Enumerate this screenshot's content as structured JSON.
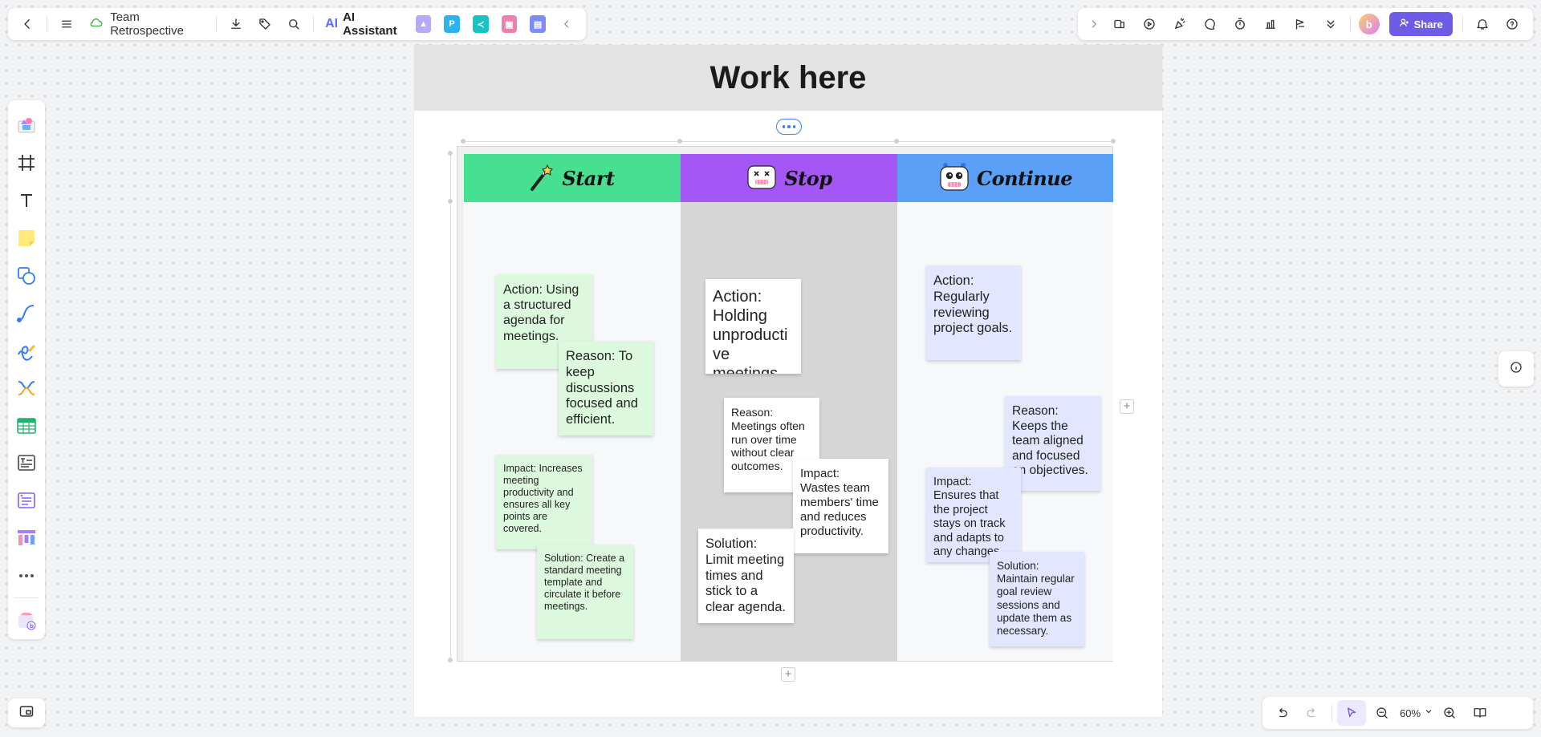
{
  "toolbar": {
    "doc_title": "Team Retrospective",
    "ai_label": "AI Assistant",
    "share_label": "Share",
    "zoom": "60%"
  },
  "frame": {
    "title": "Work here"
  },
  "columns": [
    {
      "title": "Start",
      "color": "#46e090",
      "body_color": "#f6f8fa"
    },
    {
      "title": "Stop",
      "color": "#a457f5",
      "body_color": "#d6d6d6"
    },
    {
      "title": "Continue",
      "color": "#5aa0f7",
      "body_color": "#f6f8fa"
    }
  ],
  "notes": {
    "start_action": "Action: Using a structured agenda for meetings.",
    "start_reason": "Reason: To keep discussions focused and efficient.",
    "start_impact": "Impact: Increases meeting productivity and ensures all key points are covered.",
    "start_solution": "Solution: Create a standard meeting template and circulate it before meetings.",
    "stop_action": "Action: Holding unproductive meetings.",
    "stop_reason": "Reason: Meetings often run over time without clear outcomes.",
    "stop_impact": "Impact: Wastes team members' time and reduces productivity.",
    "stop_solution": "Solution: Limit meeting times and stick to a clear agenda.",
    "continue_action": "Action: Regularly reviewing project goals.",
    "continue_reason": "Reason: Keeps the team aligned and focused on objectives.",
    "continue_impact": "Impact: Ensures that the project stays on track and adapts to any changes.",
    "continue_solution": "Solution: Maintain regular goal review sessions and update them as necessary."
  },
  "icons": {
    "left_toolbar": [
      "back-icon",
      "menu-icon",
      "cloud-icon",
      "download-icon",
      "tag-icon",
      "search-icon"
    ],
    "right_toolbar": [
      "chevron-right-icon",
      "templates-icon",
      "play-icon",
      "celebrate-icon",
      "comment-icon",
      "timer-icon",
      "vote-icon",
      "flag-icon",
      "expand-more-icon",
      "bell-icon",
      "help-icon"
    ],
    "sidebar": [
      "shapes-library-icon",
      "frame-icon",
      "text-icon",
      "sticky-note-icon",
      "shape-icon",
      "connector-icon",
      "pen-icon",
      "mind-map-icon",
      "table-icon",
      "text-box-icon",
      "list-icon",
      "kanban-icon",
      "more-icon",
      "apps-icon"
    ]
  }
}
